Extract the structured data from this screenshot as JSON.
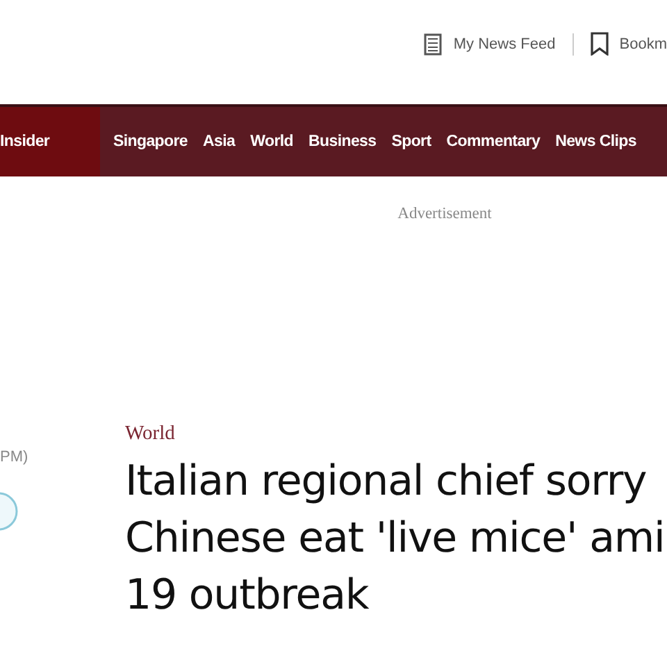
{
  "header": {
    "links": [
      {
        "kind": "feed",
        "label": "My News Feed"
      },
      {
        "kind": "bookmark",
        "label": "Bookm"
      }
    ]
  },
  "nav": {
    "items": [
      {
        "label": "Insider",
        "selected": true
      },
      {
        "label": "Singapore",
        "selected": false
      },
      {
        "label": "Asia",
        "selected": false
      },
      {
        "label": "World",
        "selected": false
      },
      {
        "label": "Business",
        "selected": false
      },
      {
        "label": "Sport",
        "selected": false
      },
      {
        "label": "Commentary",
        "selected": false
      },
      {
        "label": "News Clips",
        "selected": false
      }
    ]
  },
  "advertisement": "Advertisement",
  "sidebar": {
    "time": "PM)"
  },
  "article": {
    "category": "World",
    "headline_lines": [
      "Italian regional chief sorry",
      "Chinese eat 'live mice' ami",
      "19 outbreak"
    ]
  }
}
